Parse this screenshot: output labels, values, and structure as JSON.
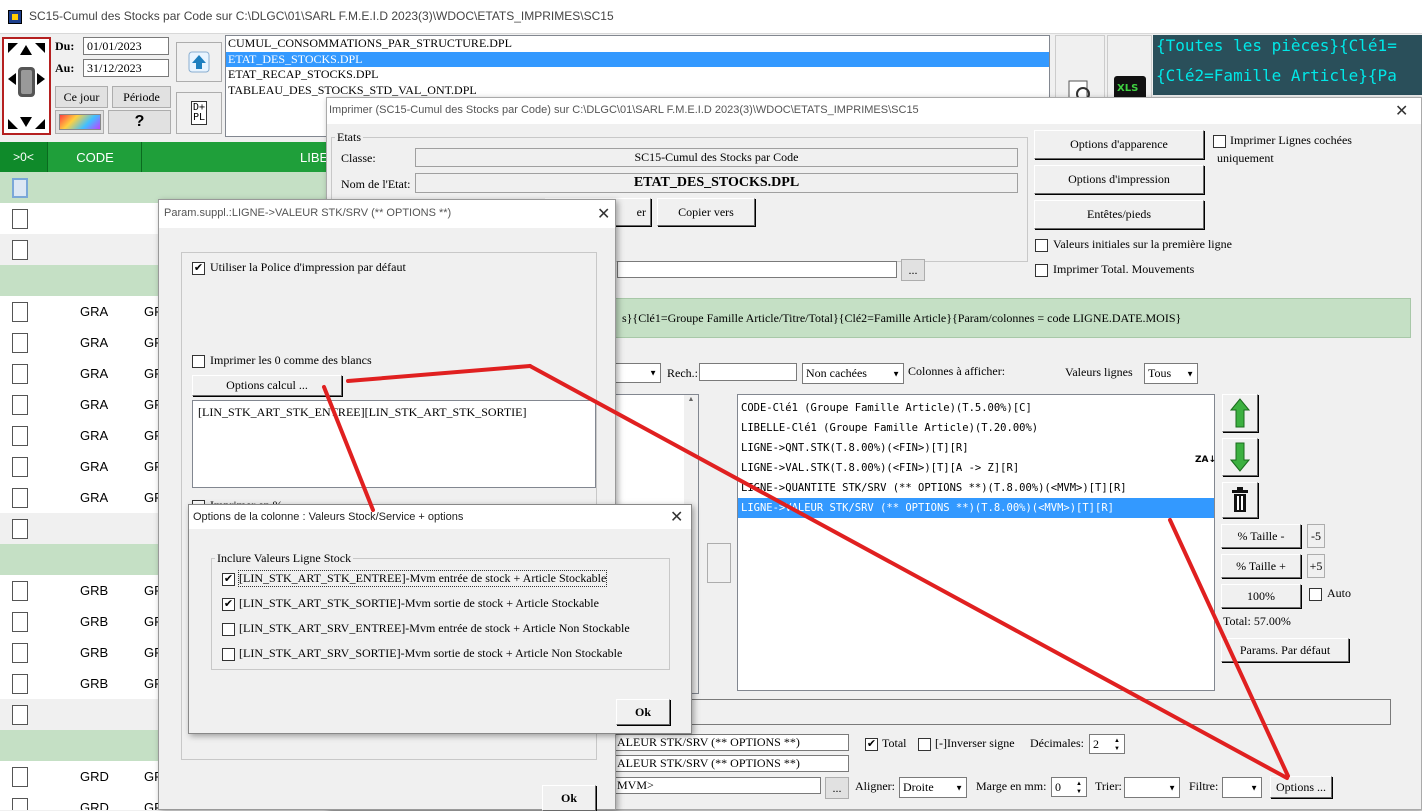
{
  "main_window": {
    "title": "SC15-Cumul des Stocks par Code sur C:\\DLGC\\01\\SARL F.M.E.I.D 2023(3)\\WDOC\\ETATS_IMPRIMES\\SC15",
    "dates": {
      "du_label": "Du:",
      "du_value": "01/01/2023",
      "au_label": "Au:",
      "au_value": "31/12/2023"
    },
    "ce_jour_label": "Ce jour",
    "periode_label": "Période",
    "help_label": "?",
    "reports_list": [
      "CUMUL_CONSOMMATIONS_PAR_STRUCTURE.DPL",
      "ETAT_DES_STOCKS.DPL",
      "ETAT_RECAP_STOCKS.DPL",
      "TABLEAU_DES_STOCKS_STD_VAL_ONT.DPL"
    ],
    "selected_report_index": 1,
    "top_right_line1": "{Toutes les pièces}{Clé1=",
    "top_right_line2": "{Clé2=Famille Article}{Pa",
    "xls_label": "XLS",
    "grid": {
      "header_toggle": ">0<",
      "header_code": "CODE",
      "header_libelle": "LIBE",
      "rows": [
        {
          "kind": "green",
          "code": "",
          "lib": ""
        },
        {
          "kind": "white",
          "code": "",
          "lib": ""
        },
        {
          "kind": "grey",
          "code": "",
          "lib": ""
        },
        {
          "kind": "green",
          "code": "",
          "lib": ""
        },
        {
          "kind": "white",
          "code": "GRA",
          "lib": "GR"
        },
        {
          "kind": "white",
          "code": "GRA",
          "lib": "GR"
        },
        {
          "kind": "white",
          "code": "GRA",
          "lib": "GR"
        },
        {
          "kind": "white",
          "code": "GRA",
          "lib": "GR"
        },
        {
          "kind": "white",
          "code": "GRA",
          "lib": "GR"
        },
        {
          "kind": "white",
          "code": "GRA",
          "lib": "GR"
        },
        {
          "kind": "white",
          "code": "GRA",
          "lib": "GR"
        },
        {
          "kind": "grey",
          "code": "",
          "lib": ""
        },
        {
          "kind": "green",
          "code": "",
          "lib": ""
        },
        {
          "kind": "white",
          "code": "GRB",
          "lib": "GR"
        },
        {
          "kind": "white",
          "code": "GRB",
          "lib": "GR"
        },
        {
          "kind": "white",
          "code": "GRB",
          "lib": "GR"
        },
        {
          "kind": "white",
          "code": "GRB",
          "lib": "GR"
        },
        {
          "kind": "grey",
          "code": "",
          "lib": ""
        },
        {
          "kind": "green",
          "code": "",
          "lib": ""
        },
        {
          "kind": "white",
          "code": "GRD",
          "lib": "GR"
        },
        {
          "kind": "white",
          "code": "GRD",
          "lib": "GR"
        }
      ]
    }
  },
  "print_dialog": {
    "title": "Imprimer (SC15-Cumul des Stocks par Code)  sur C:\\DLGC\\01\\SARL F.M.E.I.D 2023(3)\\WDOC\\ETATS_IMPRIMES\\SC15",
    "etats_group": "Etats",
    "classe_label": "Classe:",
    "classe_value": "SC15-Cumul des Stocks par Code",
    "nom_label": "Nom de l'Etat:",
    "nom_value": "ETAT_DES_STOCKS.DPL",
    "copier_label_partial": "er",
    "copier_vers_label": "Copier vers",
    "options_apparence_label": "Options d'apparence",
    "options_impression_label": "Options d'impression",
    "entetes_pieds_label": "Entêtes/pieds",
    "imprimer_lignes_cochees_label": "Imprimer Lignes cochées uniquement",
    "valeurs_initiales_label": "Valeurs initiales sur la première ligne",
    "imprimer_total_mvts_label": "Imprimer Total. Mouvements",
    "browse_label": "...",
    "params_banner": "s}{Clé1=Groupe Famille Article/Titre/Total}{Clé2=Famille Article}{Param/colonnes = code LIGNE.DATE.MOIS}",
    "rech_label": "Rech.:",
    "non_cachees_value": "Non cachées",
    "colonnes_label": "Colonnes à afficher:",
    "valeurs_lignes_label": "Valeurs lignes",
    "valeurs_lignes_value": "Tous",
    "columns": [
      "CODE-Clé1 (Groupe Famille Article)(T.5.00%)[C]",
      "LIBELLE-Clé1 (Groupe Famille Article)(T.20.00%)",
      "LIGNE->QNT.STK(T.8.00%)(<FIN>)[T][R]",
      "LIGNE->VAL.STK(T.8.00%)(<FIN>)[T][A -> Z][R]",
      "LIGNE->QUANTITE STK/SRV (** OPTIONS **)(T.8.00%)(<MVM>)[T][R]",
      "LIGNE->VALEUR STK/SRV (** OPTIONS **)(T.8.00%)(<MVM>)[T][R]"
    ],
    "selected_column_index": 5,
    "sort_icon_text": "ZA",
    "taille_minus_label": "% Taille -",
    "taille_minus_value": "-5",
    "taille_plus_label": "% Taille +",
    "taille_plus_value": "+5",
    "pct100_label": "100%",
    "auto_label": "Auto",
    "total_label": "Total:  57.00%",
    "params_defaut_label": "Params. Par défaut",
    "col_name_1": "ALEUR STK/SRV (** OPTIONS **)",
    "col_name_2": "ALEUR STK/SRV (** OPTIONS **)",
    "col_format": "MVM>",
    "total_chk_label": "Total",
    "inverser_label": "[-]Inverser signe",
    "decimales_label": "Décimales:",
    "decimales_value": "2",
    "aligner_label": "Aligner:",
    "aligner_value": "Droite",
    "marge_label": "Marge en mm:",
    "marge_value": "0",
    "trier_label": "Trier:",
    "filtre_label": "Filtre:",
    "options_label": "Options ..."
  },
  "param_dialog": {
    "title": "Param.suppl.:LIGNE->VALEUR STK/SRV (** OPTIONS **)",
    "utiliser_police_label": "Utiliser la Police d'impression par défaut",
    "imprimer_zeros_label": "Imprimer les 0 comme des blancs",
    "options_calcul_label": "Options calcul ...",
    "formula": "[LIN_STK_ART_STK_ENTREE][LIN_STK_ART_STK_SORTIE]",
    "imprimer_pct_partial": "Imprimer en %",
    "ok_label": "Ok"
  },
  "column_options_dialog": {
    "title": "Options de la colonne : Valeurs Stock/Service + options",
    "group_label": "Inclure Valeurs Ligne Stock",
    "options": [
      {
        "label": "[LIN_STK_ART_STK_ENTREE]-Mvm entrée de stock + Article Stockable",
        "checked": true
      },
      {
        "label": "[LIN_STK_ART_STK_SORTIE]-Mvm sortie de stock + Article Stockable",
        "checked": true
      },
      {
        "label": "[LIN_STK_ART_SRV_ENTREE]-Mvm entrée de stock + Article Non Stockable",
        "checked": false
      },
      {
        "label": "[LIN_STK_ART_SRV_SORTIE]-Mvm sortie de stock + Article Non Stockable",
        "checked": false
      }
    ],
    "ok_label": "Ok"
  },
  "colors": {
    "accent": "#3399ff",
    "banner_green": "#c5e0c5",
    "grid_header": "#1f9f3a",
    "annotation_red": "#e02020",
    "top_right_bg": "#2a4f5a",
    "top_right_text": "#00e8e8"
  }
}
